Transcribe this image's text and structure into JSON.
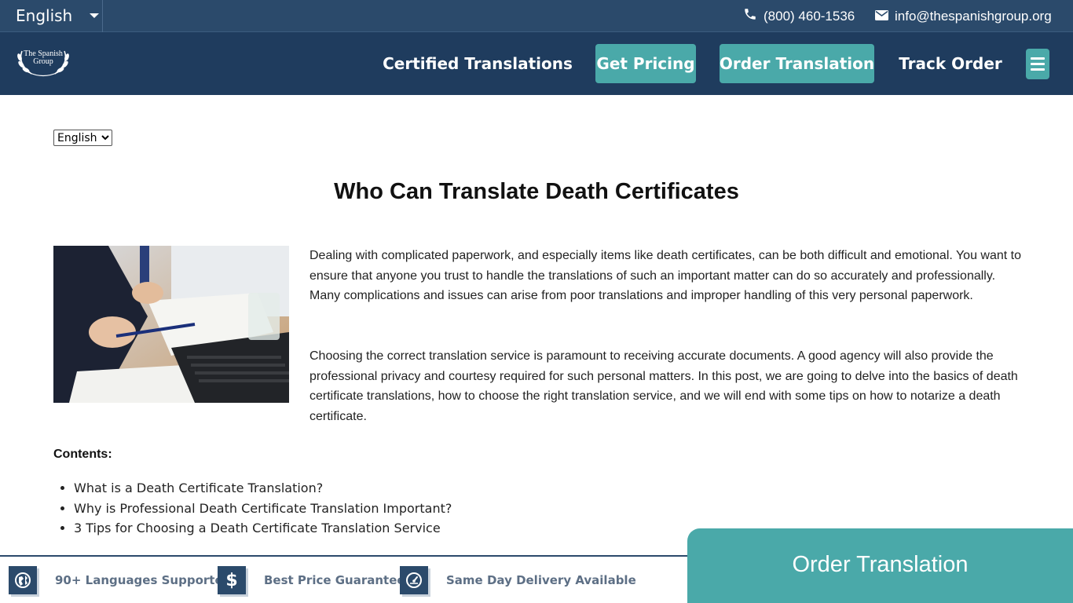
{
  "topbar": {
    "language": "English",
    "phone": "(800) 460-1536",
    "email": "info@thespanishgroup.org"
  },
  "logo": {
    "line1": "The Spanish",
    "line2": "Group"
  },
  "nav": {
    "certified": "Certified Translations",
    "pricing": "Get Pricing",
    "order": "Order Translation",
    "track": "Track Order"
  },
  "content": {
    "language_select": "English",
    "title": "Who Can Translate Death Certificates",
    "intro": [
      "Dealing with complicated paperwork, and especially items like death certificates, can be both difficult and emotional. You want to ensure that anyone you trust to handle the translations of such an important matter can do so accurately and professionally. Many complications and issues can arise from poor translations and improper handling of this very personal paperwork.",
      "Choosing the correct translation service is paramount to receiving accurate documents. A good agency will also provide the professional privacy and courtesy required for such personal matters. In this post, we are going to delve into the basics of death certificate translations, how to choose the right translation service, and we will end with some tips on how to notarize a death certificate."
    ],
    "contents_heading": "Contents:",
    "toc": [
      "What is a Death Certificate Translation?",
      "Why is Professional Death Certificate Translation Important?",
      "3 Tips for Choosing a Death Certificate Translation Service"
    ]
  },
  "features": [
    {
      "icon": "globe-icon",
      "label": "90+ Languages Supported"
    },
    {
      "icon": "dollar-icon",
      "label": "Best Price Guarantee"
    },
    {
      "icon": "speedometer-icon",
      "label": "Same Day Delivery Available"
    }
  ],
  "cta": {
    "label": "Order Translation"
  },
  "colors": {
    "topbar": "#2b4a6b",
    "navbar": "#1f3c5e",
    "accent": "#4aa9a9"
  }
}
